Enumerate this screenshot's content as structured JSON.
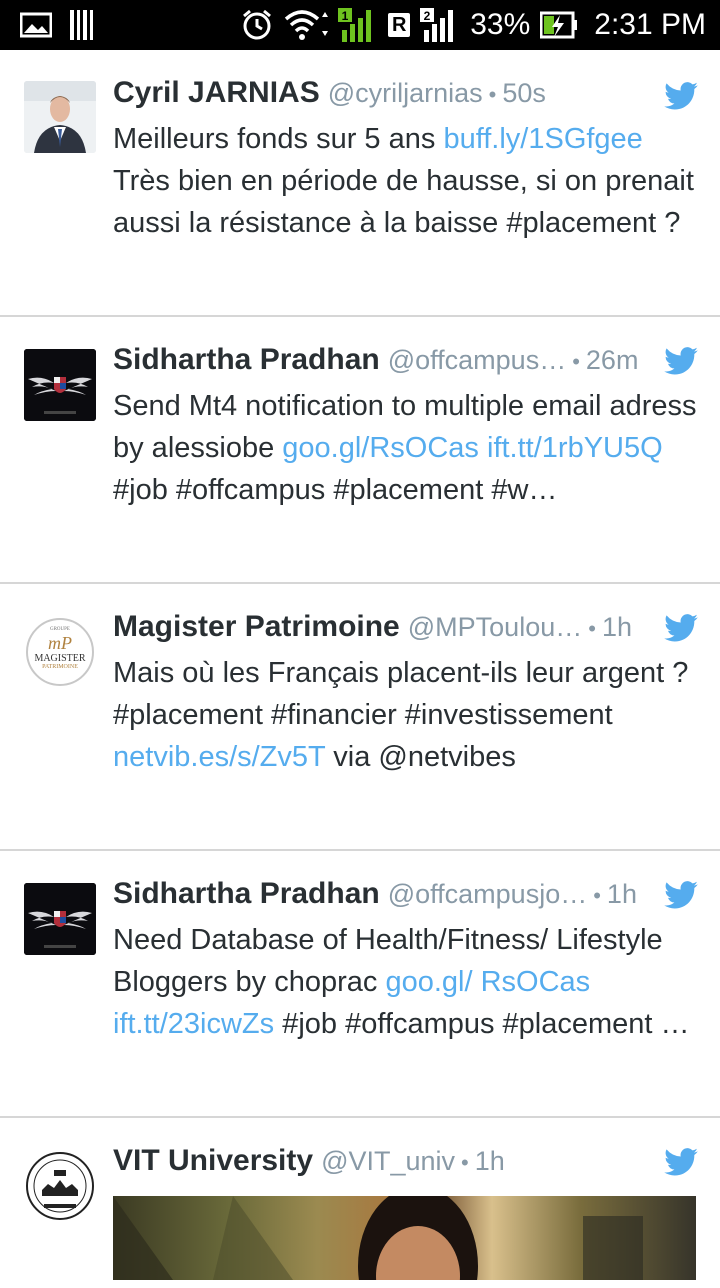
{
  "status_bar": {
    "battery_percent": "33%",
    "time": "2:31 PM",
    "sim1_label": "1",
    "sim2_label": "2",
    "roaming_label": "R",
    "icons": [
      "gallery-icon",
      "barcode-icon",
      "alarm-icon",
      "wifi-icon",
      "signal-icon",
      "battery-charging-icon"
    ]
  },
  "tweets": [
    {
      "name": "Cyril JARNIAS",
      "handle": "@cyriljarnias",
      "time": "50s",
      "segments": [
        {
          "t": "Meilleurs fonds sur 5 ans ",
          "link": false
        },
        {
          "t": "buff.ly/1SGfgee",
          "link": true
        },
        {
          "t": " Très bien en période de hausse, si on prenait aussi la résistance à la baisse #placement ?",
          "link": false
        }
      ]
    },
    {
      "name": "Sidhartha Pradhan",
      "handle": "@offcampus…",
      "time": "26m",
      "segments": [
        {
          "t": "Send Mt4 notification to multiple email adress by alessiobe ",
          "link": false
        },
        {
          "t": "goo.gl/RsOCas",
          "link": true
        },
        {
          "t": " ",
          "link": false
        },
        {
          "t": "ift.tt/1rbYU5Q",
          "link": true
        },
        {
          "t": " #job #offcampus #placement #w…",
          "link": false
        }
      ]
    },
    {
      "name": "Magister Patrimoine",
      "handle": "@MPToulou…",
      "time": "1h",
      "avatar_text": {
        "top": "GROUPE",
        "main": "MAGISTER",
        "sub": "PATRIMOINE",
        "mono": "mP"
      },
      "segments": [
        {
          "t": "Mais où les Français placent-ils leur argent ? #placement #financier #investissement ",
          "link": false
        },
        {
          "t": "netvib.es/s/Zv5T",
          "link": true
        },
        {
          "t": " via @netvibes",
          "link": false
        }
      ]
    },
    {
      "name": "Sidhartha Pradhan",
      "handle": "@offcampusjo…",
      "time": "1h",
      "segments": [
        {
          "t": "Need Database of Health/Fitness/ Lifestyle Bloggers by choprac ",
          "link": false
        },
        {
          "t": "goo.gl/ RsOCas",
          "link": true
        },
        {
          "t": " ",
          "link": false
        },
        {
          "t": "ift.tt/23icwZs",
          "link": true
        },
        {
          "t": " #job #offcampus #placement …",
          "link": false
        }
      ]
    },
    {
      "name": "VIT University",
      "handle": "@VIT_univ",
      "time": "1h",
      "segments": []
    }
  ],
  "colors": {
    "link": "#55acee",
    "name": "#292f33",
    "meta": "#8899a6",
    "divider": "#d6d6d6",
    "twitter_blue": "#55acee"
  }
}
